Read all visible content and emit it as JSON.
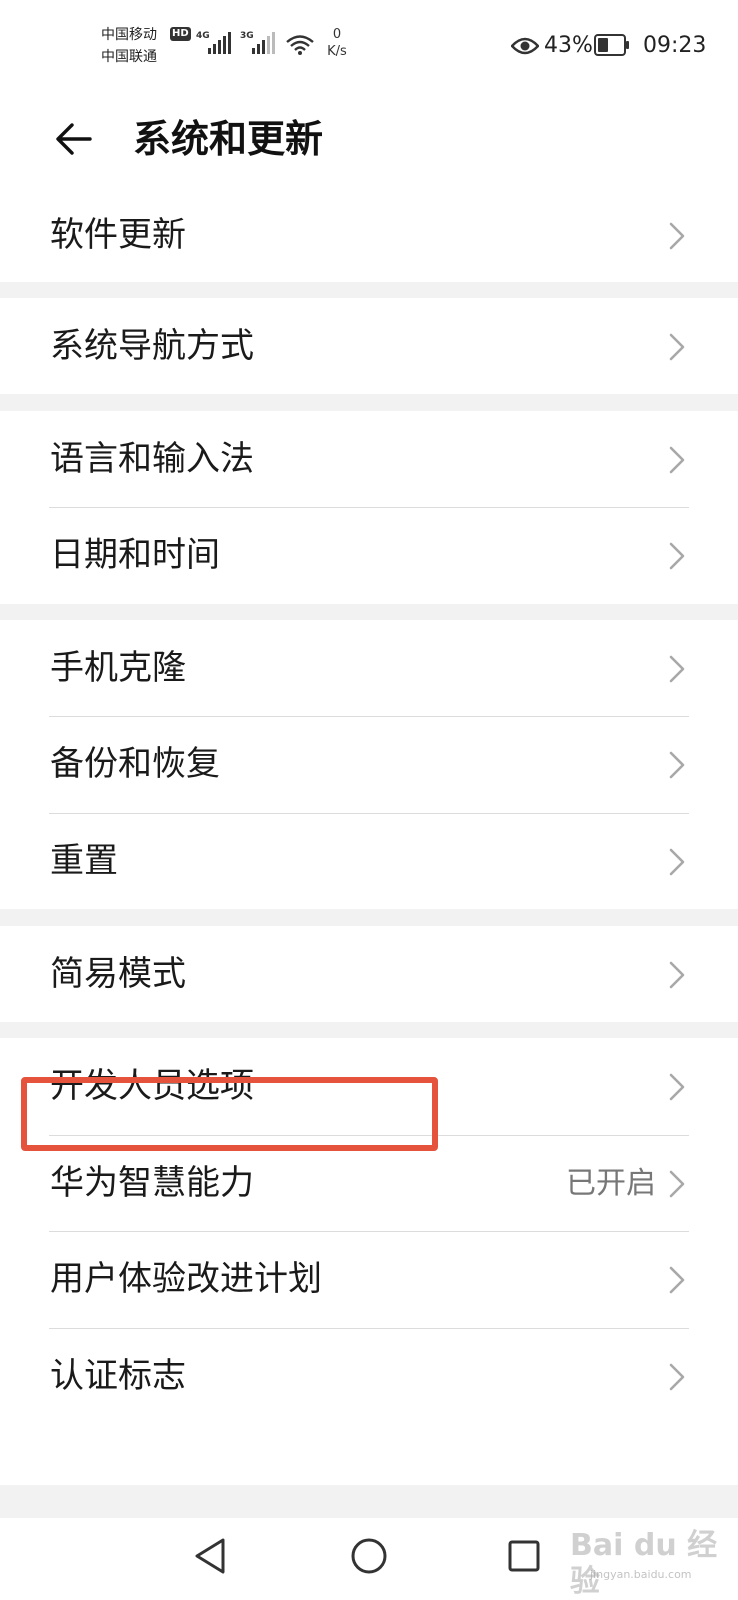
{
  "status_bar": {
    "carrier_1": "中国移动",
    "carrier_2": "中国联通",
    "hd_badge": "HD",
    "network_1": "4G",
    "network_2": "3G",
    "speed_value": "0",
    "speed_unit": "K/s",
    "battery_percent": "43%",
    "battery_level": 0.43,
    "time": "09:23",
    "icons": [
      "eye-icon",
      "signal-icon",
      "wifi-icon",
      "battery-icon"
    ]
  },
  "header": {
    "title": "系统和更新",
    "back_icon": "arrow-left-icon"
  },
  "menu": {
    "groups": [
      {
        "items": [
          {
            "label": "软件更新"
          }
        ]
      },
      {
        "items": [
          {
            "label": "系统导航方式"
          }
        ]
      },
      {
        "items": [
          {
            "label": "语言和输入法"
          },
          {
            "label": "日期和时间"
          }
        ]
      },
      {
        "items": [
          {
            "label": "手机克隆"
          },
          {
            "label": "备份和恢复"
          },
          {
            "label": "重置"
          }
        ]
      },
      {
        "items": [
          {
            "label": "简易模式"
          }
        ]
      },
      {
        "items": [
          {
            "label": "开发人员选项",
            "highlighted": true
          },
          {
            "label": "华为智慧能力",
            "value": "已开启"
          },
          {
            "label": "用户体验改进计划"
          },
          {
            "label": "认证标志"
          }
        ]
      }
    ]
  },
  "highlight_color": "#e5533d",
  "nav_bar": {
    "icons": [
      "triangle-back-icon",
      "circle-home-icon",
      "square-recent-icon"
    ]
  },
  "watermark": {
    "text": "Bai du 经验",
    "sub": "jingyan.baidu.com"
  }
}
